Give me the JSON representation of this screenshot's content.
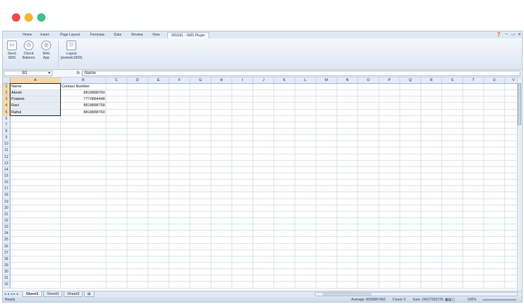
{
  "window_dots": {
    "red": "#ee4b4b",
    "yellow": "#f2b630",
    "green": "#3fc08f"
  },
  "ribbon_tabs": [
    "Home",
    "Insert",
    "Page Layout",
    "Formulas",
    "Data",
    "Review",
    "View",
    "MSG91 - SMS Plugin"
  ],
  "active_tab": "MSG91 - SMS Plugin",
  "ribbon_buttons": [
    {
      "label1": "Send",
      "label2": "SMS",
      "icon": "monitor-icon"
    },
    {
      "label1": "Check",
      "label2": "Balance",
      "icon": "clock-icon"
    },
    {
      "label1": "Web",
      "label2": "App",
      "icon": "globe-icon"
    },
    {
      "label1": "Logout",
      "label2": "(prateek1909)",
      "icon": "logout-icon"
    }
  ],
  "formula_bar": {
    "name_box": "B1",
    "fx": "fx",
    "content": "Name"
  },
  "columns": [
    "A",
    "B",
    "C",
    "D",
    "E",
    "F",
    "G",
    "H",
    "I",
    "J",
    "K",
    "L",
    "M",
    "N",
    "O",
    "P",
    "Q",
    "R",
    "S",
    "T",
    "U",
    "V"
  ],
  "row_count": 32,
  "cells": [
    [
      "Name",
      "Contact Number"
    ],
    [
      "Akesh",
      "8818888760"
    ],
    [
      "Prateek",
      "7770884448"
    ],
    [
      "Ravi",
      "8818888758"
    ],
    [
      "Rahul",
      "8818888760"
    ]
  ],
  "sheet_tabs": [
    "Sheet1",
    "Sheet2",
    "Sheet3"
  ],
  "status": {
    "ready": "Ready",
    "average": "Average: 8556887482",
    "count": "Count: 5",
    "sum": "Sum: 34227550726",
    "zoom": "100%"
  },
  "colors": {
    "accent": "#f9d8a8",
    "header": "#e4ecf7",
    "ribbon": "#dfe8f3"
  }
}
